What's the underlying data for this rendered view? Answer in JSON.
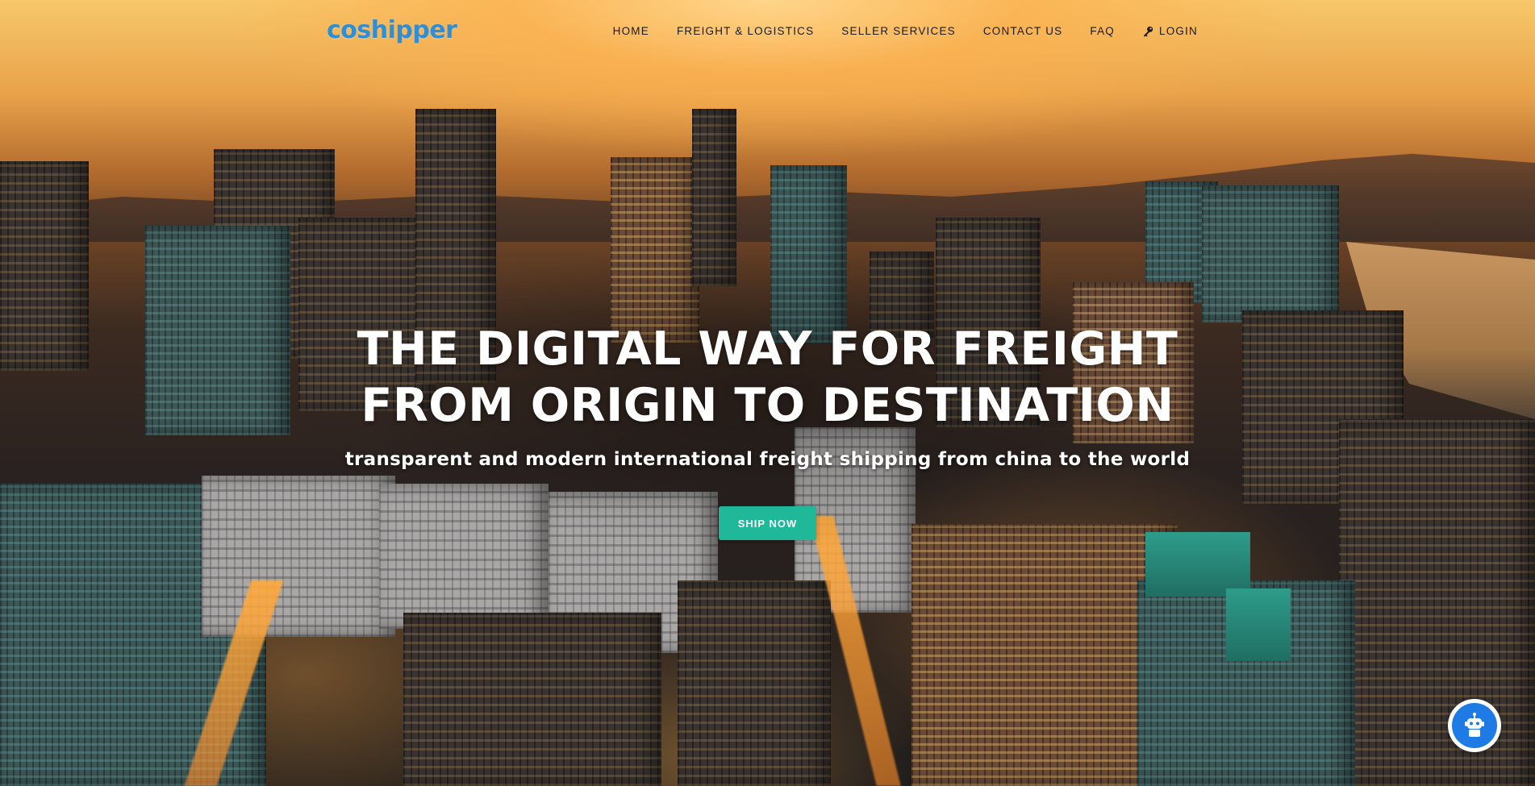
{
  "brand": {
    "logo_text": "coshipper",
    "logo_color": "#2f8fd6"
  },
  "nav": {
    "items": [
      {
        "label": "HOME"
      },
      {
        "label": "FREIGHT & LOGISTICS"
      },
      {
        "label": "SELLER SERVICES"
      },
      {
        "label": "CONTACT US"
      },
      {
        "label": "FAQ"
      }
    ],
    "login": {
      "label": "LOGIN",
      "icon": "key-icon"
    }
  },
  "hero": {
    "headline_line1": "THE DIGITAL WAY FOR FREIGHT",
    "headline_line2": "FROM ORIGIN TO DESTINATION",
    "subheadline": "transparent and modern international freight shipping from china to the world",
    "cta_label": "SHIP NOW",
    "cta_color": "#1fb899",
    "background": "city-skyline-sunset-photo"
  },
  "chat": {
    "icon": "robot-icon",
    "color": "#1e7be6"
  }
}
